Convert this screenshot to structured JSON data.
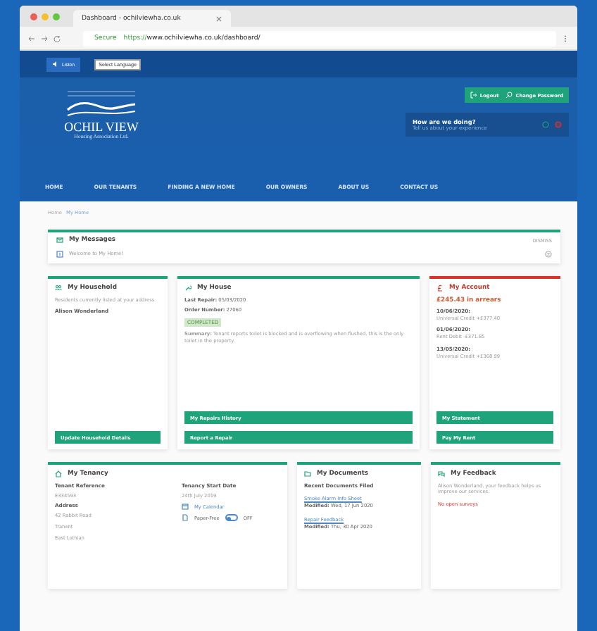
{
  "browser": {
    "tab_title": "Dashboard - ochilviewha.co.uk",
    "secure": "Secure",
    "url_scheme": "https://",
    "url_rest": "www.ochilviewha.co.uk/dashboard/"
  },
  "header": {
    "listen": "Listen",
    "language": "Select Language"
  },
  "account_actions": [
    "Logout",
    "Change Password"
  ],
  "logo": {
    "name": "OCHIL VIEW",
    "tagline": "Housing Association Ltd."
  },
  "feedback_widget": {
    "title": "How are we doing?",
    "subtitle": "Tell us about your experience"
  },
  "nav": [
    "HOME",
    "OUR TENANTS",
    "FINDING A NEW HOME",
    "OUR OWNERS",
    "ABOUT US",
    "CONTACT US"
  ],
  "breadcrumbs": [
    "Home",
    "My Home"
  ],
  "messages": {
    "title": "My Messages",
    "dismiss": "DISMISS",
    "items": [
      "Welcome to My Home!"
    ]
  },
  "household": {
    "title": "My Household",
    "intro": "Residents currently listed at your address",
    "residents": [
      "Alison Wonderland"
    ],
    "button": "Update Household Details"
  },
  "house": {
    "title": "My House",
    "last_repair_label": "Last Repair:",
    "last_repair": "05/03/2020",
    "order_label": "Order Number:",
    "order": "27060",
    "status": "COMPLETED",
    "summary": "**Summary:** Tenant reports toilet is blocked and is overflowing when flushed, this is the only toilet in the property.",
    "buttons": [
      "My Repairs History",
      "Report a Repair"
    ]
  },
  "account": {
    "title": "My Account",
    "arrears": "£245.43 in arrears",
    "entries": [
      {
        "date": "10/06/2020:",
        "detail": "Universal Credit +£377.40"
      },
      {
        "date": "01/06/2020:",
        "detail": "Rent Debit -£371.85"
      },
      {
        "date": "13/05/2020:",
        "detail": "Universal Credit +£368.99"
      }
    ],
    "buttons": [
      "My Statement",
      "Pay My Rent"
    ]
  },
  "tenancy": {
    "title": "My Tenancy",
    "reference_label": "Tenant Reference",
    "reference": "E334593",
    "address_label": "Address",
    "address": [
      "42 Rabbit Road",
      "Tranent",
      "East Lothian"
    ],
    "start_label": "Tenancy Start Date",
    "start": "24th July 2019",
    "calendar": "My Calendar",
    "paper_free": {
      "label": "Paper-Free",
      "on": false,
      "state": "OFF"
    }
  },
  "documents": {
    "title": "My Documents",
    "heading": "Recent Documents Filed",
    "items": [
      {
        "name": "Smoke Alarm Info Sheet",
        "modified_label": "Modified:",
        "modified": "Wed, 17 Jun 2020"
      },
      {
        "name": "Repair Feedback",
        "modified_label": "Modified:",
        "modified": "Thu, 30 Apr 2020"
      }
    ]
  },
  "feedback": {
    "title": "My Feedback",
    "text": "Alison Wonderland, your feedback helps us improve our services.",
    "surveys": "No open surveys"
  }
}
